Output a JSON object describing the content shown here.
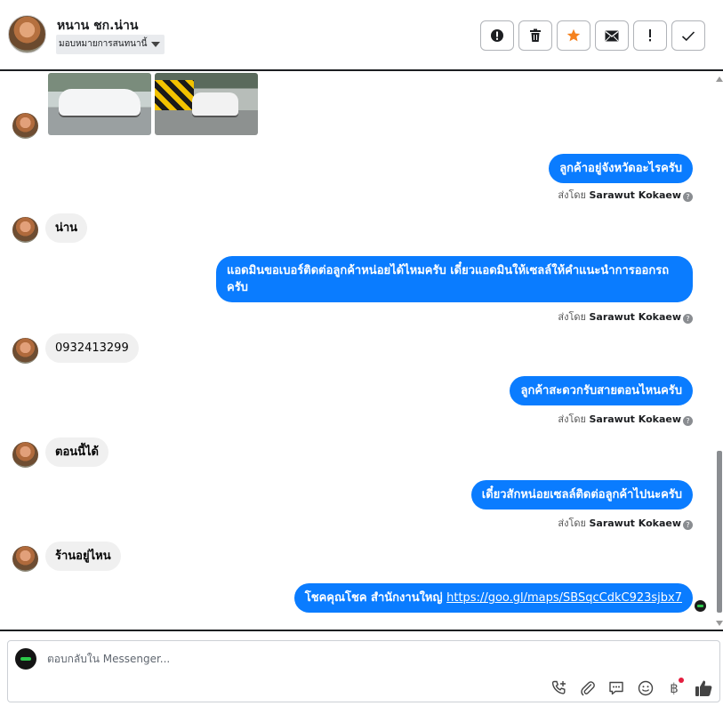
{
  "header": {
    "contact_name": "หนาน ชก.น่าน",
    "assign_label": "มอบหมายการสนทนานี้",
    "tools": [
      {
        "icon": "spam-icon"
      },
      {
        "icon": "trash-icon"
      },
      {
        "icon": "star-icon",
        "color": "#f5821f"
      },
      {
        "icon": "mail-icon"
      },
      {
        "icon": "important-icon"
      },
      {
        "icon": "check-icon"
      }
    ]
  },
  "messages": [
    {
      "direction": "in",
      "type": "images",
      "count": 2
    },
    {
      "direction": "out",
      "text": "ลูกค้าอยู่จังหวัดอะไรครับ",
      "sent_by_prefix": "ส่งโดย",
      "sent_by": "Sarawut Kokaew"
    },
    {
      "direction": "in",
      "text": "น่าน"
    },
    {
      "direction": "out",
      "text": "แอดมินขอเบอร์ติดต่อลูกค้าหน่อยได้ไหมครับ เดี๋ยวแอดมินให้เซลล์ให้คำแนะนำการออกรถครับ",
      "sent_by_prefix": "ส่งโดย",
      "sent_by": "Sarawut Kokaew"
    },
    {
      "direction": "in",
      "text": "0932413299"
    },
    {
      "direction": "out",
      "text": "ลูกค้าสะดวกรับสายตอนไหนครับ",
      "sent_by_prefix": "ส่งโดย",
      "sent_by": "Sarawut Kokaew"
    },
    {
      "direction": "in",
      "text": "ตอนนี้ได้"
    },
    {
      "direction": "out",
      "text": "เดี๋ยวสักหน่อยเซลล์ติดต่อลูกค้าไปนะครับ",
      "sent_by_prefix": "ส่งโดย",
      "sent_by": "Sarawut Kokaew"
    },
    {
      "direction": "in",
      "text": "ร้านอยู่ไหน"
    },
    {
      "direction": "out",
      "text": "โชคคุณโชค สำนักงานใหญ่ ",
      "link": "https://goo.gl/maps/SBSqcCdkC923sjbx7"
    }
  ],
  "composer": {
    "placeholder": "ตอบกลับใน Messenger...",
    "tools": [
      "call-icon",
      "attach-icon",
      "saved-reply-icon",
      "emoji-icon",
      "baht-payment-icon",
      "like-icon"
    ],
    "baht_symbol": "฿"
  },
  "colors": {
    "outgoing_bubble": "#0a7cff",
    "incoming_bubble": "#f0f0f0",
    "star": "#f5821f"
  }
}
